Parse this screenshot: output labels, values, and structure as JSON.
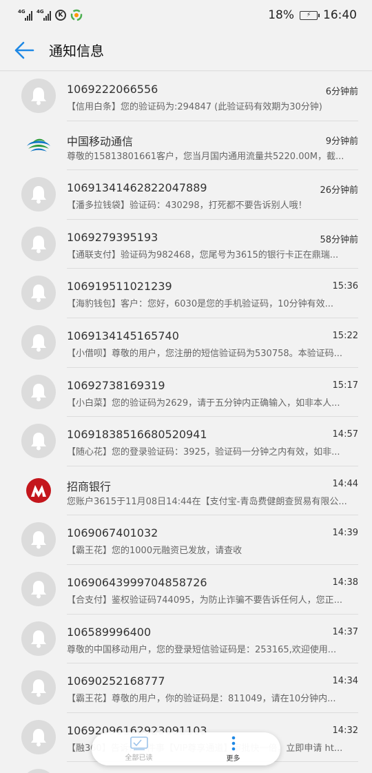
{
  "status_bar": {
    "network_1": "4G",
    "network_2": "4G",
    "k_icon": "K",
    "battery_percent": "18%",
    "time": "16:40"
  },
  "header": {
    "title": "通知信息"
  },
  "messages": [
    {
      "sender": "1069222066556",
      "time": "6分钟前",
      "preview": "【信用白条】您的验证码为:294847 (此验证码有效期为30分钟)",
      "avatar": "bell-icon"
    },
    {
      "sender": "中国移动通信",
      "time": "9分钟前",
      "preview": "尊敬的15813801661客户，您当月国内通用流量共5220.00M，截...",
      "avatar": "china-mobile-logo"
    },
    {
      "sender": "10691341462822047889",
      "time": "26分钟前",
      "preview": "【潘多拉钱袋】验证码：430298，打死都不要告诉别人哦！",
      "avatar": "bell-icon"
    },
    {
      "sender": "1069279395193",
      "time": "58分钟前",
      "preview": "【通联支付】验证码为982468，您尾号为3615的银行卡正在鼎瑞...",
      "avatar": "bell-icon"
    },
    {
      "sender": "106919511021239",
      "time": "15:36",
      "preview": "【海豹钱包】客户：您好，6030是您的手机验证码，10分钟有效...",
      "avatar": "bell-icon"
    },
    {
      "sender": "1069134145165740",
      "time": "15:22",
      "preview": "【小借呗】尊敬的用户，您注册的短信验证码为530758。本验证码...",
      "avatar": "bell-icon"
    },
    {
      "sender": "10692738169319",
      "time": "15:17",
      "preview": "【小白菜】您的验证码为2629，请于五分钟内正确输入，如非本人...",
      "avatar": "bell-icon"
    },
    {
      "sender": "10691838516680520941",
      "time": "14:57",
      "preview": "【随心花】您的登录验证码：3925，验证码一分钟之内有效，如非...",
      "avatar": "bell-icon"
    },
    {
      "sender": "招商银行",
      "time": "14:44",
      "preview": "您账户3615于11月08日14:44在【支付宝-青岛费健朗查贸易有限公...",
      "avatar": "cmb-logo"
    },
    {
      "sender": "1069067401032",
      "time": "14:39",
      "preview": "【霸王花】您的1000元融资已发放，请查收",
      "avatar": "bell-icon"
    },
    {
      "sender": "10690643999704858726",
      "time": "14:38",
      "preview": "【合支付】鉴权验证码744095，为防止诈骗不要告诉任何人，您正...",
      "avatar": "bell-icon"
    },
    {
      "sender": "106589996400",
      "time": "14:37",
      "preview": "尊敬的中国移动用户，您的登录短信验证码是：253165,欢迎使用...",
      "avatar": "bell-icon"
    },
    {
      "sender": "10690252168777",
      "time": "14:34",
      "preview": "【霸王花】尊敬的用户，你的验证码是：811049，请在10分钟内...",
      "avatar": "bell-icon"
    },
    {
      "sender": "10692096162923091103",
      "time": "14:32",
      "preview": "【融360】告诉你一件事【VIP尊享通道】审批快一倍，立即申请 ht...",
      "avatar": "bell-icon"
    },
    {
      "sender": "",
      "time": "",
      "preview": "",
      "avatar": "bell-icon"
    }
  ],
  "bottom_bar": {
    "mark_all_read": "全部已读",
    "more": "更多"
  },
  "colors": {
    "accent": "#1e88e5",
    "background": "#f2f2f2",
    "avatar_bg": "#dcdcdc"
  }
}
